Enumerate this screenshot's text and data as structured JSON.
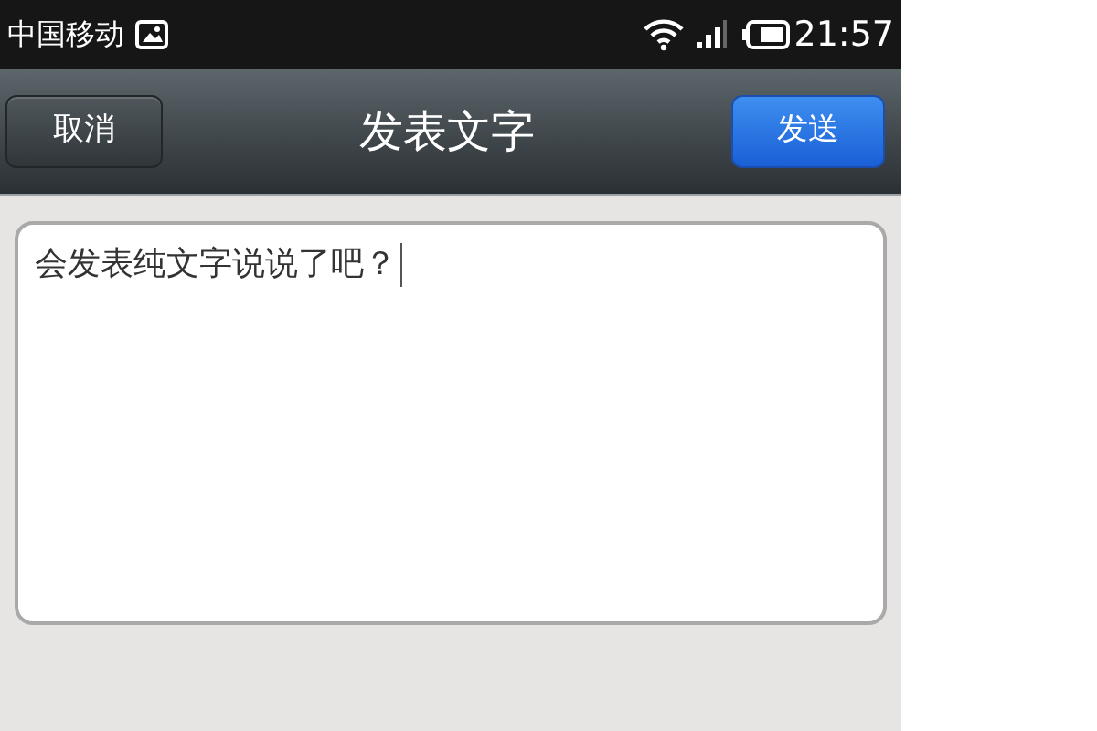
{
  "status_bar": {
    "carrier": "中国移动",
    "time": "21:57"
  },
  "nav_bar": {
    "title": "发表文字",
    "left_button": "取消",
    "right_button": "发送"
  },
  "text_field": {
    "value": "会发表纯文字说说了吧？"
  }
}
